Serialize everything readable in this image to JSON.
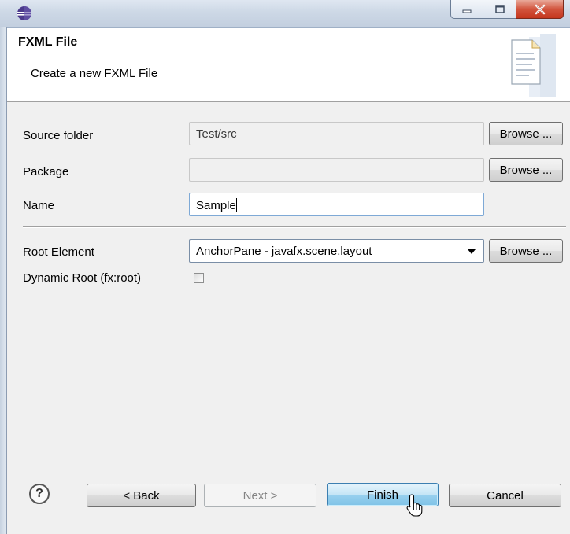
{
  "window": {
    "title_icon": "eclipse-icon",
    "controls": [
      "minimize",
      "maximize",
      "close"
    ]
  },
  "header": {
    "title": "FXML File",
    "description": "Create a new FXML File",
    "image": "new-file-wizard-icon"
  },
  "form": {
    "source_folder": {
      "label": "Source folder",
      "value": "Test/src",
      "browse": "Browse ..."
    },
    "package": {
      "label": "Package",
      "value": "",
      "browse": "Browse ..."
    },
    "name": {
      "label": "Name",
      "value": "Sample"
    },
    "root_element": {
      "label": "Root Element",
      "selected": "AnchorPane - javafx.scene.layout",
      "browse": "Browse ..."
    },
    "dynamic_root": {
      "label": "Dynamic Root (fx:root)",
      "checked": false
    }
  },
  "footer": {
    "help": "?",
    "back": "< Back",
    "next": "Next >",
    "finish": "Finish",
    "cancel": "Cancel"
  },
  "colors": {
    "titlebar": "#cdd8e6",
    "close_button": "#d2553e",
    "focused_button": "#98d1ef",
    "panel": "#f0f0f0"
  }
}
